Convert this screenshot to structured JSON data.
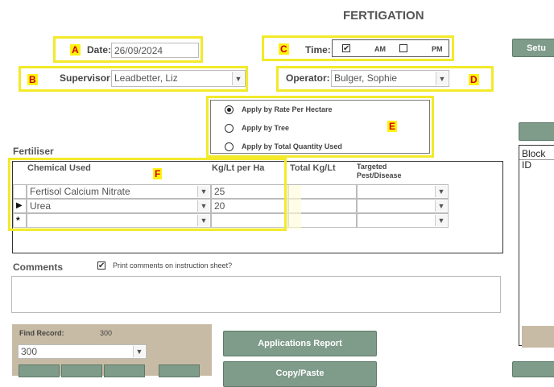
{
  "page_title": "FERTIGATION",
  "markers": {
    "a": "A",
    "b": "B",
    "c": "C",
    "d": "D",
    "e": "E",
    "f": "F"
  },
  "date": {
    "label": "Date:",
    "value": "26/09/2024"
  },
  "time": {
    "label": "Time:",
    "am_label": "AM",
    "pm_label": "PM",
    "am_checked": true,
    "pm_checked": false
  },
  "supervisor": {
    "label": "Supervisor:",
    "value": "Leadbetter, Liz"
  },
  "operator": {
    "label": "Operator:",
    "value": "Bulger, Sophie"
  },
  "apply_options": {
    "selected": "rate_per_hectare",
    "items": [
      {
        "key": "rate_per_hectare",
        "label": "Apply by Rate Per Hectare"
      },
      {
        "key": "tree",
        "label": "Apply by Tree"
      },
      {
        "key": "total_quantity",
        "label": "Apply by Total Quantity Used"
      }
    ]
  },
  "fertiliser": {
    "section_label": "Fertiliser",
    "columns": {
      "chemical": "Chemical Used",
      "kg_lt": "Kg/Lt per Ha",
      "total": "Total Kg/Lt",
      "target_line1": "Targeted",
      "target_line2": "Pest/Disease"
    },
    "rows": [
      {
        "chemical": "Fertisol Calcium Nitrate",
        "kg_lt": "25"
      },
      {
        "chemical": "Urea",
        "kg_lt": "20"
      }
    ],
    "new_row_symbol": "*",
    "current_row_symbol": "▶"
  },
  "comments": {
    "label": "Comments",
    "print_label": "Print comments on instruction sheet?",
    "print_checked": true
  },
  "find_record": {
    "label": "Find Record:",
    "count": "300",
    "value": "300"
  },
  "buttons": {
    "applications_report": "Applications Report",
    "copy_paste": "Copy/Paste",
    "setup": "Setu"
  },
  "right_panel": {
    "block_id_header": "Block ID"
  },
  "icons": {
    "dropdown": "chevron-down-icon",
    "check": "check-icon"
  }
}
